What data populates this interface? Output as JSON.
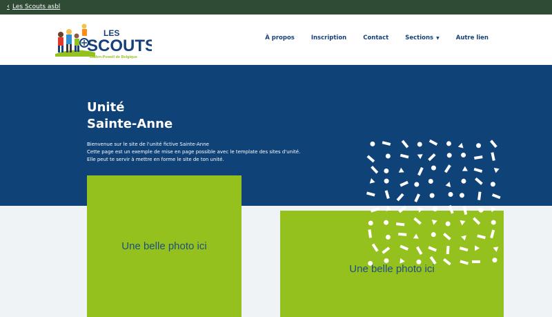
{
  "topbar": {
    "back_link": "Les Scouts asbl"
  },
  "logo": {
    "line1": "LES",
    "line2": "SCOUTS",
    "tagline": "Baden-Powell de Belgique"
  },
  "nav": {
    "items": [
      {
        "label": "À propos",
        "dropdown": false
      },
      {
        "label": "Inscription",
        "dropdown": false
      },
      {
        "label": "Contact",
        "dropdown": false
      },
      {
        "label": "Sections",
        "dropdown": true
      },
      {
        "label": "Autre lien",
        "dropdown": false
      }
    ]
  },
  "hero": {
    "title_line1": "Unité",
    "title_line2": "Sainte-Anne",
    "text_lines": [
      "Bienvenue sur le site de l'unité fictive Sainte-Anne",
      "Cette page est un exemple de mise en page possible avec le template des sites d'unité.",
      "Elle peut te servir à mettre en forme le site de ton unité."
    ]
  },
  "photos": [
    {
      "label": "Une belle photo ici"
    },
    {
      "label": "Une belle photo ici"
    }
  ],
  "colors": {
    "topbar": "#2f4a35",
    "brand_blue": "#0f4277",
    "nav_text": "#16407a",
    "photo_green": "#95c11f",
    "background": "#f0f3f6"
  }
}
